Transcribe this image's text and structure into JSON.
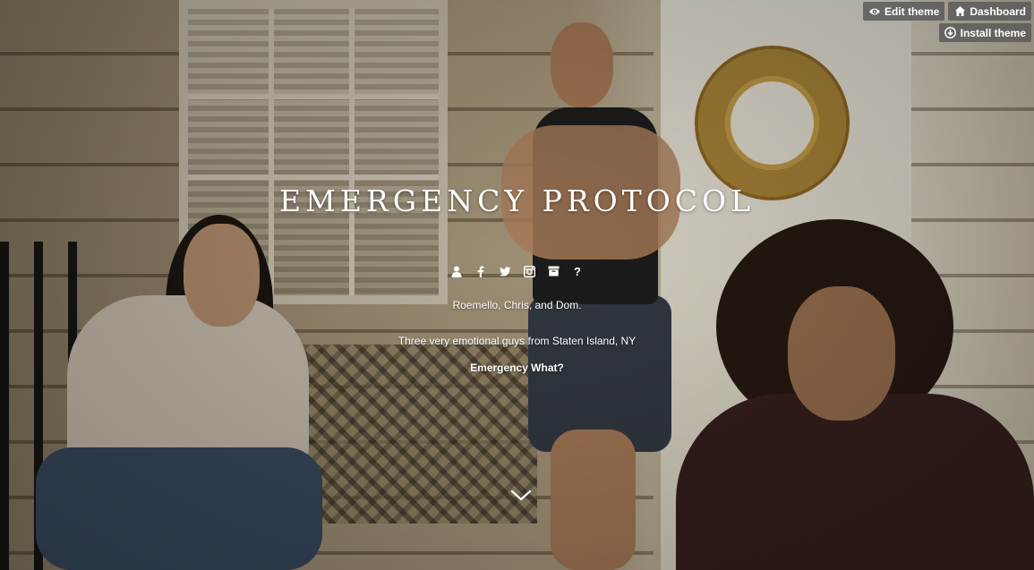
{
  "admin_controls": {
    "edit_theme_label": "Edit theme",
    "dashboard_label": "Dashboard",
    "install_theme_label": "Install theme",
    "icons": [
      "eye-icon",
      "home-icon",
      "download-icon"
    ]
  },
  "blog": {
    "title": "EMERGENCY PROTOCOL",
    "nav_icons": [
      "person-icon",
      "facebook-icon",
      "twitter-icon",
      "instagram-icon",
      "archive-icon",
      "question-icon"
    ],
    "question_glyph": "?",
    "description_line1": "Roemello, Chris, and Dom.",
    "description_line2": "Three very emotional guys from Staten Island, NY",
    "description_link": "Emergency What?"
  },
  "scroll_down_icon": "chevron-down-icon",
  "colors": {
    "text": "#ffffff",
    "button_bg": "#5a5a5a"
  }
}
